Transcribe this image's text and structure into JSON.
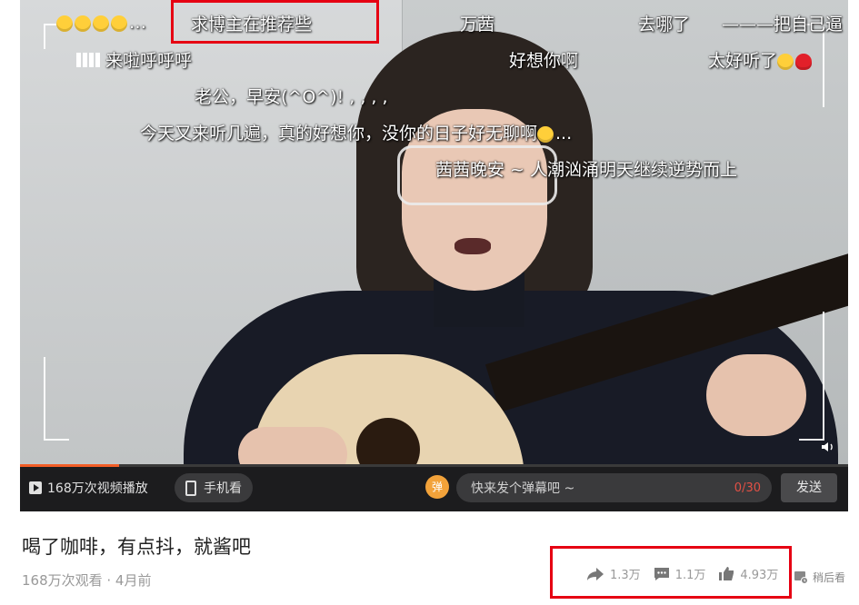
{
  "danmaku": {
    "top_left": "…",
    "highlight_text": "求博主在推荐些",
    "d1": "万茜",
    "d2": "去哪了",
    "d3": "———把自己逼",
    "d4": "来啦呼呼呼",
    "d5": "好想你啊",
    "d6": "太好听了",
    "d7": "老公，早安(^O^)! , , , ,",
    "d8": "今天又来听几遍，真的好想你，没你的日子好无聊啊",
    "d8_tail": "...",
    "d9": "茜茜晚安 ~ 人潮汹涌明天继续逆势而上"
  },
  "controls": {
    "play_count": "168万次视频播放",
    "mobile_watch": "手机看",
    "danmaku_avatar": "弹",
    "danmaku_placeholder": "快来发个弹幕吧 ~",
    "danmaku_counter": "0/30",
    "send": "发送",
    "progress": 0.12
  },
  "video": {
    "title": "喝了咖啡，有点抖，就酱吧",
    "meta": "168万次观看 · 4月前",
    "share_count": "1.3万",
    "comment_count": "1.1万",
    "like_count": "4.93万",
    "watch_later": "稍后看"
  },
  "colors": {
    "highlight_box": "#e60012",
    "accent": "#f25d26"
  }
}
